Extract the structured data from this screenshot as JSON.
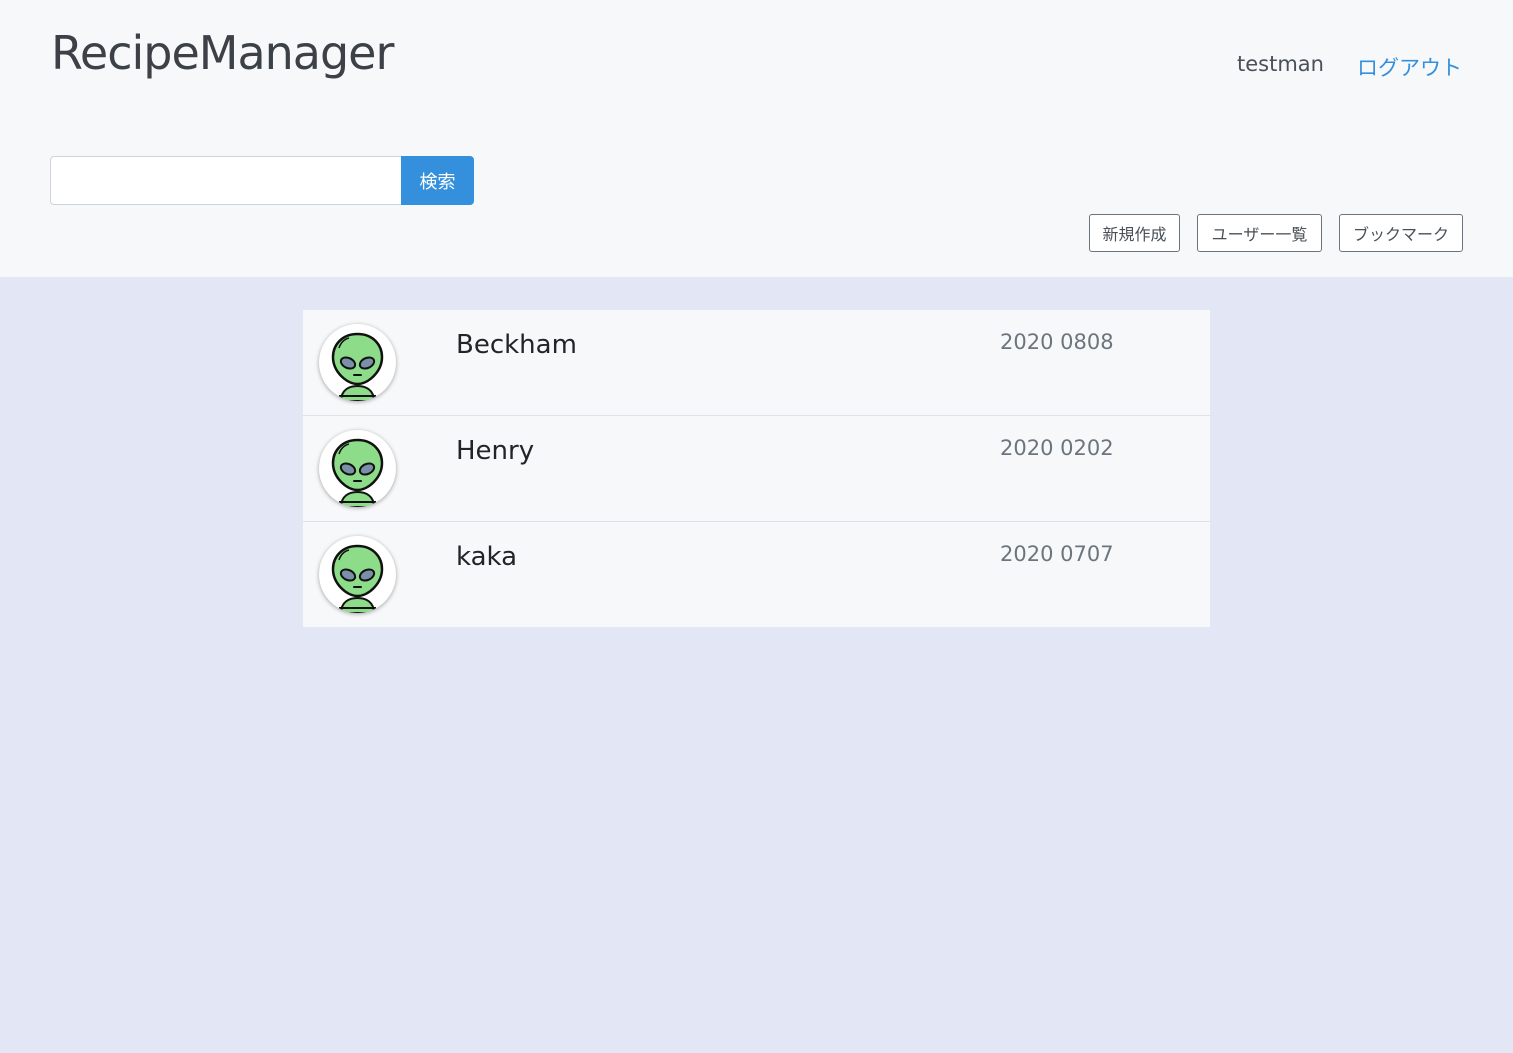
{
  "header": {
    "brand": "RecipeManager",
    "username": "testman",
    "logout_label": "ログアウト"
  },
  "search": {
    "placeholder": "",
    "value": "",
    "button_label": "検索"
  },
  "nav": {
    "new_label": "新規作成",
    "users_label": "ユーザー一覧",
    "bookmark_label": "ブックマーク"
  },
  "users": [
    {
      "name": "Beckham",
      "date": "2020 0808",
      "avatar_icon": "alien-icon"
    },
    {
      "name": "Henry",
      "date": "2020 0202",
      "avatar_icon": "alien-icon"
    },
    {
      "name": "kaka",
      "date": "2020 0707",
      "avatar_icon": "alien-icon"
    }
  ],
  "colors": {
    "accent": "#3490dc",
    "header_bg": "#f7f8fa",
    "page_bg": "#e3e6f4",
    "avatar_green": "#8ddc8a"
  }
}
